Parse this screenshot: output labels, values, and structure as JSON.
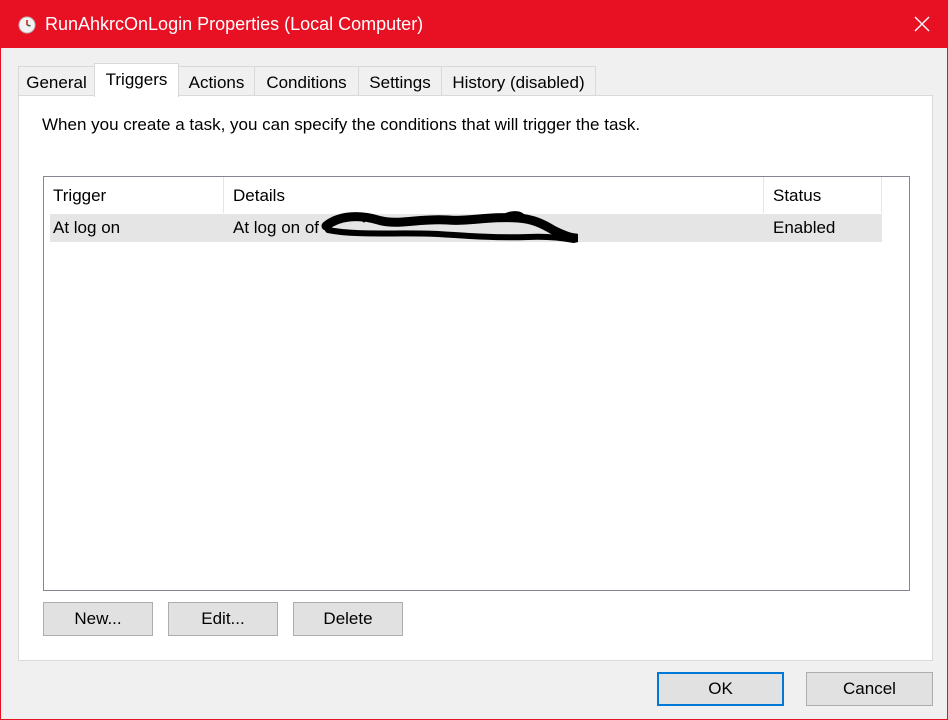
{
  "window": {
    "title": "RunAhkrcOnLogin Properties (Local Computer)",
    "title_bar_color": "#e81123",
    "icon": "clock-icon",
    "close_icon": "close-icon"
  },
  "tabs": [
    {
      "label": "General",
      "active": false
    },
    {
      "label": "Triggers",
      "active": true
    },
    {
      "label": "Actions",
      "active": false
    },
    {
      "label": "Conditions",
      "active": false
    },
    {
      "label": "Settings",
      "active": false
    },
    {
      "label": "History (disabled)",
      "active": false
    }
  ],
  "triggers_tab": {
    "description": "When you create a task, you can specify the conditions that will trigger the task.",
    "columns": [
      "Trigger",
      "Details",
      "Status"
    ],
    "rows": [
      {
        "trigger": "At log on",
        "details": "At log on of",
        "status": "Enabled",
        "selected": true
      }
    ],
    "buttons": {
      "new": "New...",
      "edit": "Edit...",
      "delete": "Delete"
    }
  },
  "dialog_buttons": {
    "ok": "OK",
    "cancel": "Cancel",
    "accent_color": "#0078d7"
  }
}
